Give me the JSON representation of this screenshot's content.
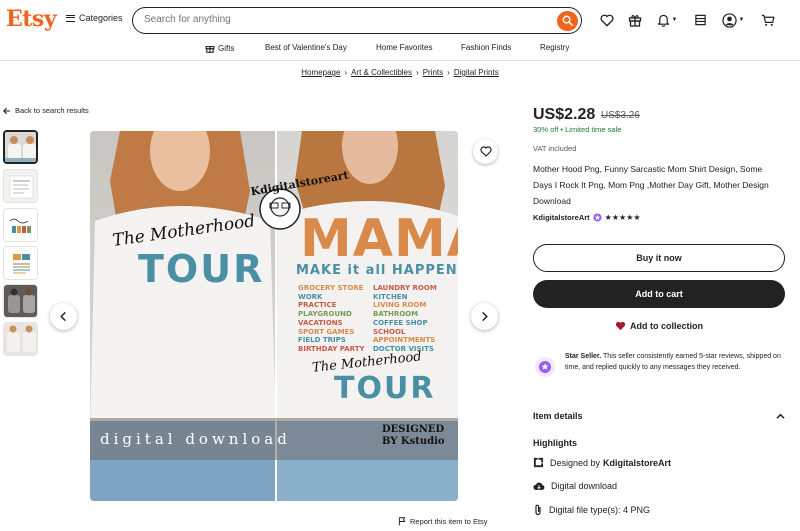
{
  "header": {
    "logo": "Etsy",
    "categories_label": "Categories",
    "search_placeholder": "Search for anything"
  },
  "nav": {
    "items": [
      "Gifts",
      "Best of Valentine's Day",
      "Home Favorites",
      "Fashion Finds",
      "Registry"
    ]
  },
  "breadcrumbs": [
    "Homepage",
    "Art & Collectibles",
    "Prints",
    "Digital Prints"
  ],
  "back_link": "Back to search results",
  "image": {
    "left_shirt": [
      "The Motherhood",
      "TOUR"
    ],
    "watermark": "Kdigitalstoreart",
    "big_word": "MAMA",
    "tagline": "MAKE it all HAPPEN",
    "list_left": [
      "GROCERY STORE",
      "WORK",
      "PRACTICE",
      "PLAYGROUND",
      "VACATIONS",
      "SPORT GAMES",
      "FIELD TRIPS",
      "BIRTHDAY PARTY"
    ],
    "list_right": [
      "LAUNDRY ROOM",
      "KITCHEN",
      "LIVING ROOM",
      "BATHROOM",
      "COFFEE SHOP",
      "SCHOOL",
      "APPOINTMENTS",
      "DOCTOR VISITS"
    ],
    "right_shirt": [
      "The Motherhood",
      "TOUR"
    ],
    "banner_text": "digital download",
    "designed_by": [
      "DESIGNED",
      "BY Kstudio"
    ]
  },
  "report_link": "Report this item to Etsy",
  "product": {
    "price": "US$2.28",
    "old_price": "US$3.26",
    "sale_pct": "30% off",
    "sale_note": "Limited time sale",
    "vat": "VAT included",
    "title": "Mother Hood Png, Funny Sarcastic Mom Shirt Design, Some Days I Rock It Png, Mom Png ,Mother Day Gift, Mother Design Download",
    "shop_name": "KdigitalstoreArt",
    "stars": "★★★★★",
    "buy_now": "Buy it now",
    "add_to_cart": "Add to cart",
    "add_to_collection": "Add to collection",
    "star_seller_title": "Star Seller.",
    "star_seller_text": "This seller consistently earned 5-star reviews, shipped on time, and replied quickly to any messages they received.",
    "item_details": "Item details",
    "highlights": "Highlights",
    "designed_by": "Designed by",
    "designer": "KdigitalstoreArt",
    "digital_download": "Digital download",
    "file_types": "Digital file type(s): 4 PNG"
  },
  "colors": {
    "brand": "#f1641e",
    "sale_green": "#1b7c36",
    "heart_red": "#a61a2e",
    "star_seller_purple": "#9560f0"
  }
}
